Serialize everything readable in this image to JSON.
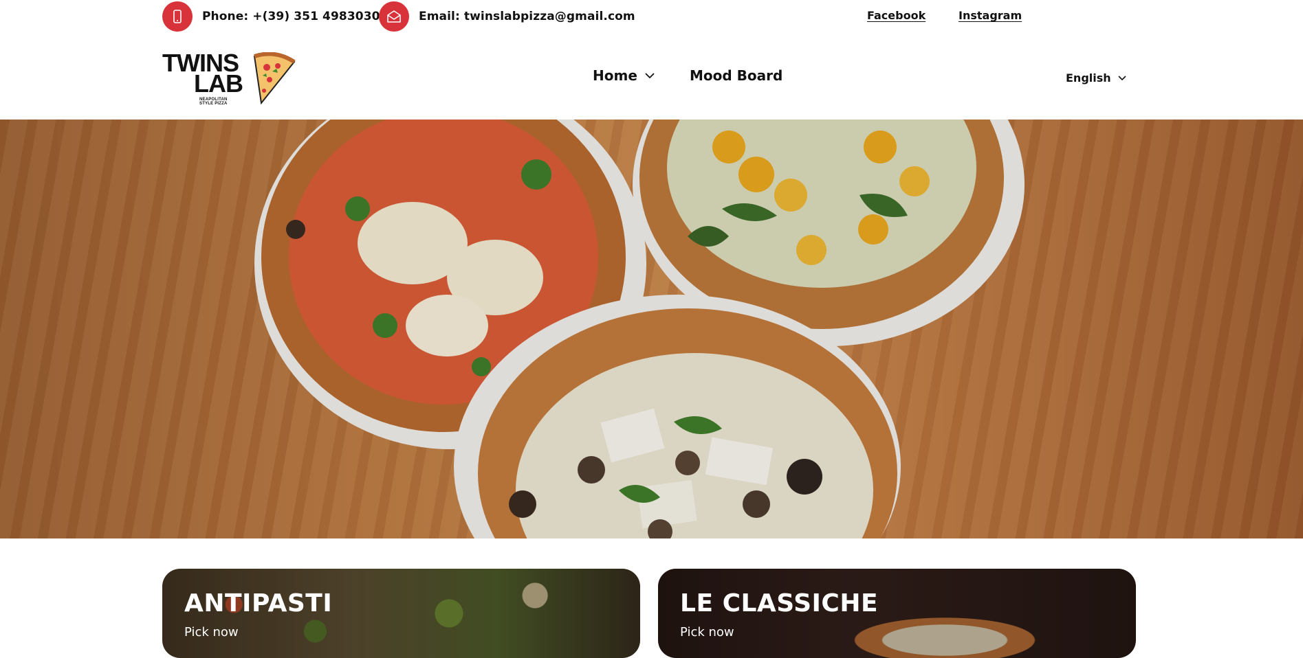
{
  "topbar": {
    "phone_label": "Phone: +(39) 351 4983030",
    "email_label": "Email: twinslabpizza@gmail.com",
    "facebook_label": "Facebook",
    "instagram_label": "Instagram",
    "icons": {
      "phone": "mobile-phone-icon",
      "email": "envelope-icon"
    },
    "accent_color": "#d8323a"
  },
  "logo": {
    "line1": "TWINS",
    "line2": "LAB",
    "subtitle": "NEAPOLITAN STYLE PIZZA",
    "icon": "pizza-slice-icon"
  },
  "nav": {
    "home_label": "Home",
    "mood_label": "Mood Board",
    "language_label": "English"
  },
  "hero": {
    "image": "three-pizzas-on-wooden-table"
  },
  "categories": [
    {
      "title": "ANTIPASTI",
      "cta": "Pick now"
    },
    {
      "title": "LE CLASSICHE",
      "cta": "Pick now"
    }
  ]
}
